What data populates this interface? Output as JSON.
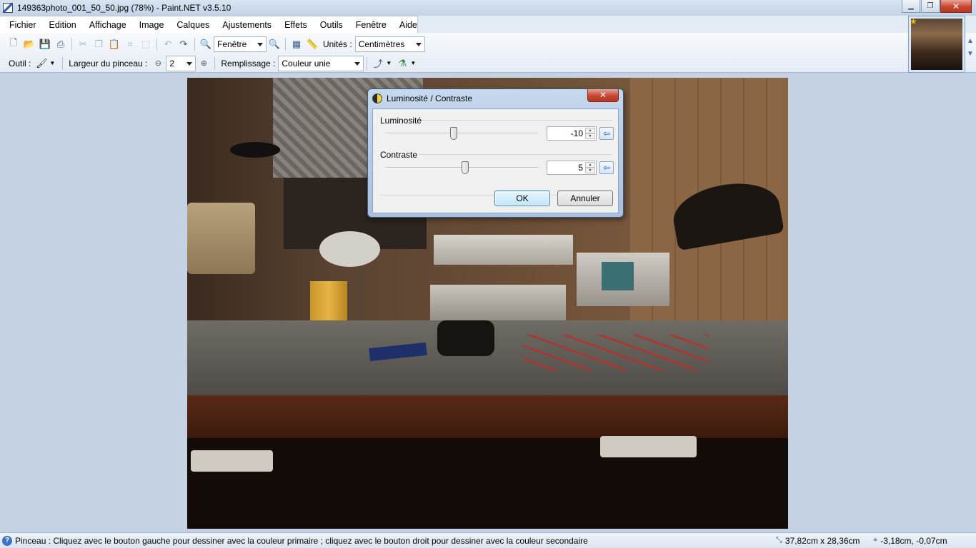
{
  "window": {
    "title": "149363photo_001_50_50.jpg (78%) - Paint.NET v3.5.10",
    "minimize": "▁",
    "restore": "❐",
    "close": "✕"
  },
  "menu": {
    "items": [
      "Fichier",
      "Edition",
      "Affichage",
      "Image",
      "Calques",
      "Ajustements",
      "Effets",
      "Outils",
      "Fenêtre",
      "Aide"
    ]
  },
  "toolbar": {
    "zoom_value": "Fenêtre",
    "units_label": "Unités :",
    "units_value": "Centimètres",
    "tool_label": "Outil :",
    "brush_width_label": "Largeur du pinceau :",
    "brush_width_value": "2",
    "fill_label": "Remplissage :",
    "fill_value": "Couleur unie"
  },
  "dialog": {
    "title": "Luminosité / Contraste",
    "close": "✕",
    "brightness_label": "Luminosité",
    "brightness_value": "-10",
    "brightness_level": -10,
    "contrast_label": "Contraste",
    "contrast_value": "5",
    "contrast_level": 5,
    "ok_label": "OK",
    "cancel_label": "Annuler"
  },
  "status": {
    "message": "Pinceau : Cliquez avec le bouton gauche pour dessiner avec la couleur primaire ; cliquez avec le bouton droit pour dessiner avec la couleur secondaire",
    "image_size": "37,82cm x 28,36cm",
    "cursor_pos": "-3,18cm, -0,07cm"
  },
  "icons": [
    "new-image-icon",
    "open-icon",
    "save-icon",
    "print-icon",
    "cut-icon",
    "copy-icon",
    "paste-icon",
    "crop-icon",
    "deselect-icon",
    "undo-icon",
    "redo-icon",
    "zoom-out-icon",
    "zoom-in-icon",
    "grid-icon",
    "ruler-icon",
    "brush-icon",
    "antialias-icon",
    "blend-mode-icon",
    "help-icon"
  ],
  "colors": {
    "accent": "#3b73c4",
    "close_button": "#c9452f",
    "workspace": "#c5d2e3"
  }
}
